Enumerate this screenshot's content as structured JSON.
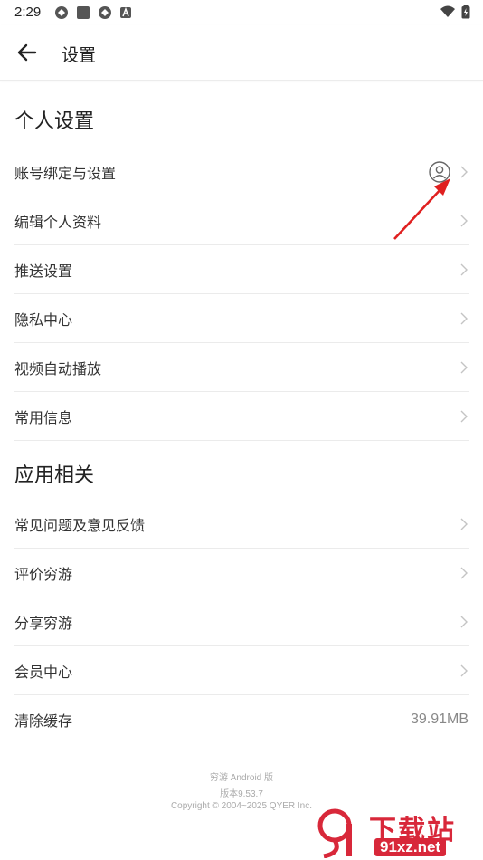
{
  "status_bar": {
    "time": "2:29"
  },
  "header": {
    "title": "设置"
  },
  "sections": [
    {
      "title": "个人设置",
      "items": [
        {
          "label": "账号绑定与设置"
        },
        {
          "label": "编辑个人资料"
        },
        {
          "label": "推送设置"
        },
        {
          "label": "隐私中心"
        },
        {
          "label": "视频自动播放"
        },
        {
          "label": "常用信息"
        }
      ]
    },
    {
      "title": "应用相关",
      "items": [
        {
          "label": "常见问题及意见反馈"
        },
        {
          "label": "评价穷游"
        },
        {
          "label": "分享穷游"
        },
        {
          "label": "会员中心"
        },
        {
          "label": "清除缓存",
          "value": "39.91MB"
        }
      ]
    }
  ],
  "footer": {
    "app_name": "穷游 Android 版",
    "version": "版本9.53.7",
    "copyright": "Copyright © 2004~2025 QYER Inc."
  },
  "watermark": {
    "text_top": "下载站",
    "text_bottom": "91xz.net"
  },
  "colors": {
    "arrow": "#e02020",
    "watermark": "#d8283a"
  },
  "icons": [
    "back-arrow-icon",
    "user-avatar-icon",
    "chevron-right-icon",
    "wifi-icon",
    "battery-icon"
  ]
}
